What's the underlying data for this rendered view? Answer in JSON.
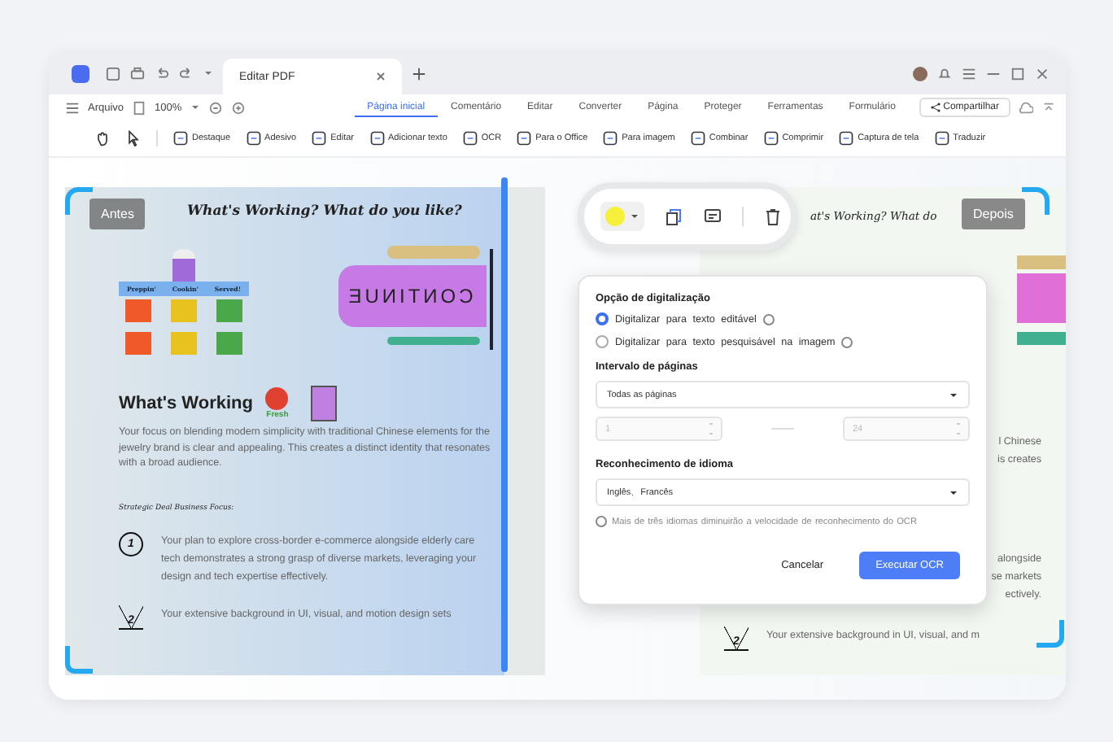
{
  "tab": {
    "title": "Editar PDF"
  },
  "menu": {
    "file": "Arquivo",
    "zoom": "100%",
    "share": "Compartilhar",
    "tabs": [
      {
        "label": "Página inicial",
        "selected": true
      },
      {
        "label": "Comentário",
        "selected": false
      },
      {
        "label": "Editar",
        "selected": false
      },
      {
        "label": "Converter",
        "selected": false
      },
      {
        "label": "Página",
        "selected": false
      },
      {
        "label": "Proteger",
        "selected": false
      },
      {
        "label": "Ferramentas",
        "selected": false
      },
      {
        "label": "Formulário",
        "selected": false
      }
    ]
  },
  "tools": [
    "Destaque",
    "Adesivo",
    "Editar",
    "Adicionar texto",
    "OCR",
    "Para o Office",
    "Para imagem",
    "Combinar",
    "Comprimir",
    "Captura de tela",
    "Traduzir"
  ],
  "before": {
    "badge": "Antes",
    "title": "What's Working? What do you like?",
    "board_labels": [
      "Preppin'",
      "Cookin'",
      "Served!"
    ],
    "banner": "ƎUИITИOƆ",
    "sticker": "Fresh",
    "heading": "What's Working",
    "paragraph": "Your focus on blending modern simplicity with traditional Chinese elements for the jewelry brand is clear and appealing. This creates a distinct identity that resonates with a broad audience.",
    "focus_label": "Strategic Deal Business Focus:",
    "items": [
      {
        "number": "1",
        "text": "Your plan to explore cross-border e-commerce alongside elderly care tech demonstrates a strong grasp of diverse markets, leveraging your design and tech expertise effectively."
      },
      {
        "number": "2",
        "text": "Your extensive background in UI, visual, and motion design sets"
      }
    ]
  },
  "after": {
    "badge": "Depois",
    "title": "at's Working? What do",
    "fragments_1": [
      "l Chinese",
      "is creates"
    ],
    "fragments_2": [
      "alongside",
      "se markets",
      "ectively."
    ],
    "item": {
      "number": "2",
      "text": "Your extensive background in UI, visual, and m"
    }
  },
  "ocr_dialog": {
    "scan_heading": "Opção de digitalização",
    "options": [
      {
        "label": "Digitalizar para texto editável",
        "selected": true
      },
      {
        "label": "Digitalizar para texto pesquisável na imagem",
        "selected": false
      }
    ],
    "range_heading": "Intervalo de páginas",
    "range_value": "Todas as páginas",
    "from_page": "1",
    "to_page": "24",
    "range_fields_disabled": true,
    "language_heading": "Reconhecimento de idioma",
    "language_value": "Inglês、Francês",
    "hint": "Mais de três idiomas diminuirão a velocidade de reconhecimento do OCR",
    "cancel": "Cancelar",
    "run": "Executar OCR"
  }
}
